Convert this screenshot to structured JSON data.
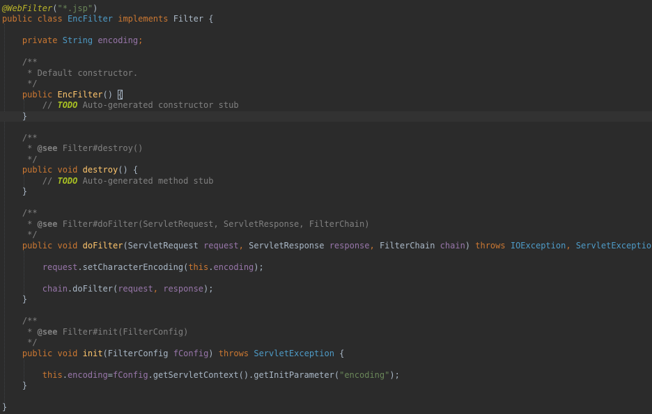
{
  "editor": {
    "lines": [
      [
        [
          "anno",
          "@WebFilter"
        ],
        [
          "txt",
          "("
        ],
        [
          "str",
          "\"*.jsp\""
        ],
        [
          "txt",
          ")"
        ]
      ],
      [
        [
          "kw",
          "public"
        ],
        [
          "txt",
          " "
        ],
        [
          "kw",
          "class"
        ],
        [
          "txt",
          " "
        ],
        [
          "typ",
          "EncFilter"
        ],
        [
          "txt",
          " "
        ],
        [
          "kw",
          "implements"
        ],
        [
          "txt",
          " "
        ],
        [
          "cls",
          "Filter"
        ],
        [
          "txt",
          " {"
        ]
      ],
      [],
      [
        [
          "txt",
          "    "
        ],
        [
          "kw",
          "private"
        ],
        [
          "txt",
          " "
        ],
        [
          "typ",
          "String"
        ],
        [
          "txt",
          " "
        ],
        [
          "fld",
          "encoding"
        ],
        [
          "kw",
          ";"
        ]
      ],
      [],
      [
        [
          "txt",
          "    "
        ],
        [
          "cmt",
          "/**"
        ]
      ],
      [
        [
          "txt",
          "    "
        ],
        [
          "cmt",
          " * Default constructor."
        ]
      ],
      [
        [
          "txt",
          "    "
        ],
        [
          "cmt",
          " */"
        ]
      ],
      [
        [
          "txt",
          "    "
        ],
        [
          "kw",
          "public"
        ],
        [
          "txt",
          " "
        ],
        [
          "fn",
          "EncFilter"
        ],
        [
          "txt",
          "() "
        ],
        [
          "cur",
          "{"
        ]
      ],
      [
        [
          "txt",
          "        "
        ],
        [
          "cmt",
          "// "
        ],
        [
          "tdo",
          "TODO"
        ],
        [
          "cmt",
          " Auto-generated constructor stub"
        ]
      ],
      [
        [
          "txt",
          "    }"
        ]
      ],
      [],
      [
        [
          "txt",
          "    "
        ],
        [
          "cmt",
          "/**"
        ]
      ],
      [
        [
          "txt",
          "    "
        ],
        [
          "cmt",
          " * "
        ],
        [
          "tagb",
          "@see"
        ],
        [
          "cmt",
          " Filter#destroy()"
        ]
      ],
      [
        [
          "txt",
          "    "
        ],
        [
          "cmt",
          " */"
        ]
      ],
      [
        [
          "txt",
          "    "
        ],
        [
          "kw",
          "public"
        ],
        [
          "txt",
          " "
        ],
        [
          "kw",
          "void"
        ],
        [
          "txt",
          " "
        ],
        [
          "fn",
          "destroy"
        ],
        [
          "txt",
          "() {"
        ]
      ],
      [
        [
          "txt",
          "        "
        ],
        [
          "cmt",
          "// "
        ],
        [
          "tdo",
          "TODO"
        ],
        [
          "cmt",
          " Auto-generated method stub"
        ]
      ],
      [
        [
          "txt",
          "    }"
        ]
      ],
      [],
      [
        [
          "txt",
          "    "
        ],
        [
          "cmt",
          "/**"
        ]
      ],
      [
        [
          "txt",
          "    "
        ],
        [
          "cmt",
          " * "
        ],
        [
          "tagb",
          "@see"
        ],
        [
          "cmt",
          " Filter#doFilter(ServletRequest, ServletResponse, FilterChain)"
        ]
      ],
      [
        [
          "txt",
          "    "
        ],
        [
          "cmt",
          " */"
        ]
      ],
      [
        [
          "txt",
          "    "
        ],
        [
          "kw",
          "public"
        ],
        [
          "txt",
          " "
        ],
        [
          "kw",
          "void"
        ],
        [
          "txt",
          " "
        ],
        [
          "fn",
          "doFilter"
        ],
        [
          "txt",
          "("
        ],
        [
          "cls",
          "ServletRequest"
        ],
        [
          "txt",
          " "
        ],
        [
          "fld",
          "request"
        ],
        [
          "kw",
          ", "
        ],
        [
          "cls",
          "ServletResponse"
        ],
        [
          "txt",
          " "
        ],
        [
          "fld",
          "response"
        ],
        [
          "kw",
          ", "
        ],
        [
          "cls",
          "FilterChain"
        ],
        [
          "txt",
          " "
        ],
        [
          "fld",
          "chain"
        ],
        [
          "txt",
          ") "
        ],
        [
          "kw",
          "throws"
        ],
        [
          "txt",
          " "
        ],
        [
          "typ",
          "IOException"
        ],
        [
          "kw",
          ", "
        ],
        [
          "typ",
          "ServletException"
        ],
        [
          "txt",
          " {"
        ]
      ],
      [],
      [
        [
          "txt",
          "        "
        ],
        [
          "fld",
          "request"
        ],
        [
          "txt",
          "."
        ],
        [
          "txt",
          "setCharacterEncoding("
        ],
        [
          "kw",
          "this"
        ],
        [
          "txt",
          "."
        ],
        [
          "fld",
          "encoding"
        ],
        [
          "txt",
          ");"
        ]
      ],
      [],
      [
        [
          "txt",
          "        "
        ],
        [
          "fld",
          "chain"
        ],
        [
          "txt",
          "."
        ],
        [
          "txt",
          "doFilter("
        ],
        [
          "fld",
          "request"
        ],
        [
          "kw",
          ", "
        ],
        [
          "fld",
          "response"
        ],
        [
          "txt",
          ");"
        ]
      ],
      [
        [
          "txt",
          "    }"
        ]
      ],
      [],
      [
        [
          "txt",
          "    "
        ],
        [
          "cmt",
          "/**"
        ]
      ],
      [
        [
          "txt",
          "    "
        ],
        [
          "cmt",
          " * "
        ],
        [
          "tagb",
          "@see"
        ],
        [
          "cmt",
          " Filter#init(FilterConfig)"
        ]
      ],
      [
        [
          "txt",
          "    "
        ],
        [
          "cmt",
          " */"
        ]
      ],
      [
        [
          "txt",
          "    "
        ],
        [
          "kw",
          "public"
        ],
        [
          "txt",
          " "
        ],
        [
          "kw",
          "void"
        ],
        [
          "txt",
          " "
        ],
        [
          "fn",
          "init"
        ],
        [
          "txt",
          "("
        ],
        [
          "cls",
          "FilterConfig"
        ],
        [
          "txt",
          " "
        ],
        [
          "fld",
          "fConfig"
        ],
        [
          "txt",
          ") "
        ],
        [
          "kw",
          "throws"
        ],
        [
          "txt",
          " "
        ],
        [
          "typ",
          "ServletException"
        ],
        [
          "txt",
          " {"
        ]
      ],
      [],
      [
        [
          "txt",
          "        "
        ],
        [
          "kw",
          "this"
        ],
        [
          "txt",
          "."
        ],
        [
          "fld",
          "encoding"
        ],
        [
          "txt",
          "="
        ],
        [
          "fld",
          "fConfig"
        ],
        [
          "txt",
          ".getServletContext().getInitParameter("
        ],
        [
          "str",
          "\"encoding\""
        ],
        [
          "txt",
          ");"
        ]
      ],
      [
        [
          "txt",
          "    }"
        ]
      ],
      [],
      [
        [
          "txt",
          "}"
        ]
      ]
    ]
  }
}
